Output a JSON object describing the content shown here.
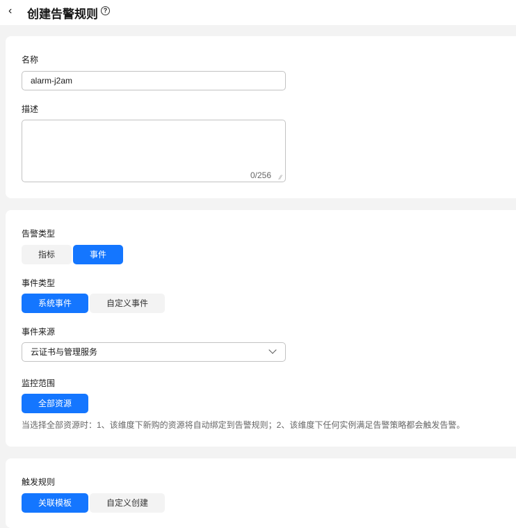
{
  "header": {
    "title": "创建告警规则",
    "back_icon": "‹",
    "help_icon": "?"
  },
  "basic": {
    "name_label": "名称",
    "name_value": "alarm-j2am",
    "desc_label": "描述",
    "desc_value": "",
    "desc_counter": "0/256"
  },
  "alarm": {
    "type_label": "告警类型",
    "types": [
      "指标",
      "事件"
    ],
    "event_type_label": "事件类型",
    "event_types": [
      "系统事件",
      "自定义事件"
    ],
    "source_label": "事件来源",
    "source_value": "云证书与管理服务",
    "scope_label": "监控范围",
    "scope_button": "全部资源",
    "scope_hint": "当选择全部资源时：1、该维度下新购的资源将自动绑定到告警规则；2、该维度下任何实例满足告警策略都会触发告警。"
  },
  "trigger": {
    "label": "触发规则",
    "options": [
      "关联模板",
      "自定义创建"
    ]
  }
}
